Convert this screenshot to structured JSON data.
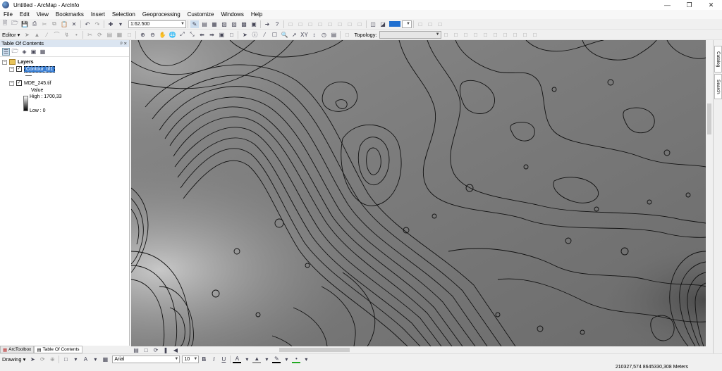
{
  "window": {
    "title": "Untitled - ArcMap - ArcInfo"
  },
  "menu": [
    "File",
    "Edit",
    "View",
    "Bookmarks",
    "Insert",
    "Selection",
    "Geoprocessing",
    "Customize",
    "Windows",
    "Help"
  ],
  "toolbar": {
    "scale_value": "1:62.500",
    "editor_label": "Editor",
    "topology_label": "Topology:"
  },
  "toc": {
    "title": "Table Of Contents",
    "header_ctrls": "ᵖ ×",
    "root_label": "Layers",
    "layers": [
      {
        "name": "Contour_tif1",
        "checked": true,
        "selected": true
      },
      {
        "name": "MDE_245.tif",
        "checked": true,
        "selected": false
      }
    ],
    "legend": {
      "field": "Value",
      "high": "High : 1700,33",
      "low": "Low : 0"
    },
    "bottom_tabs": [
      "ArcToolbox",
      "Table Of Contents"
    ]
  },
  "side_tabs": [
    "Catalog",
    "Search"
  ],
  "drawing": {
    "label": "Drawing",
    "font": "Arial",
    "size": "10",
    "bold": "B",
    "italic": "I",
    "underline": "U",
    "font_color_glyph": "A"
  },
  "status": {
    "coords": "210327,574  8645330,308 Meters"
  },
  "colors": {
    "selection": "#3a7fd4",
    "toc_header": "#dbe5f1",
    "map_base": "#7a7a7a"
  }
}
